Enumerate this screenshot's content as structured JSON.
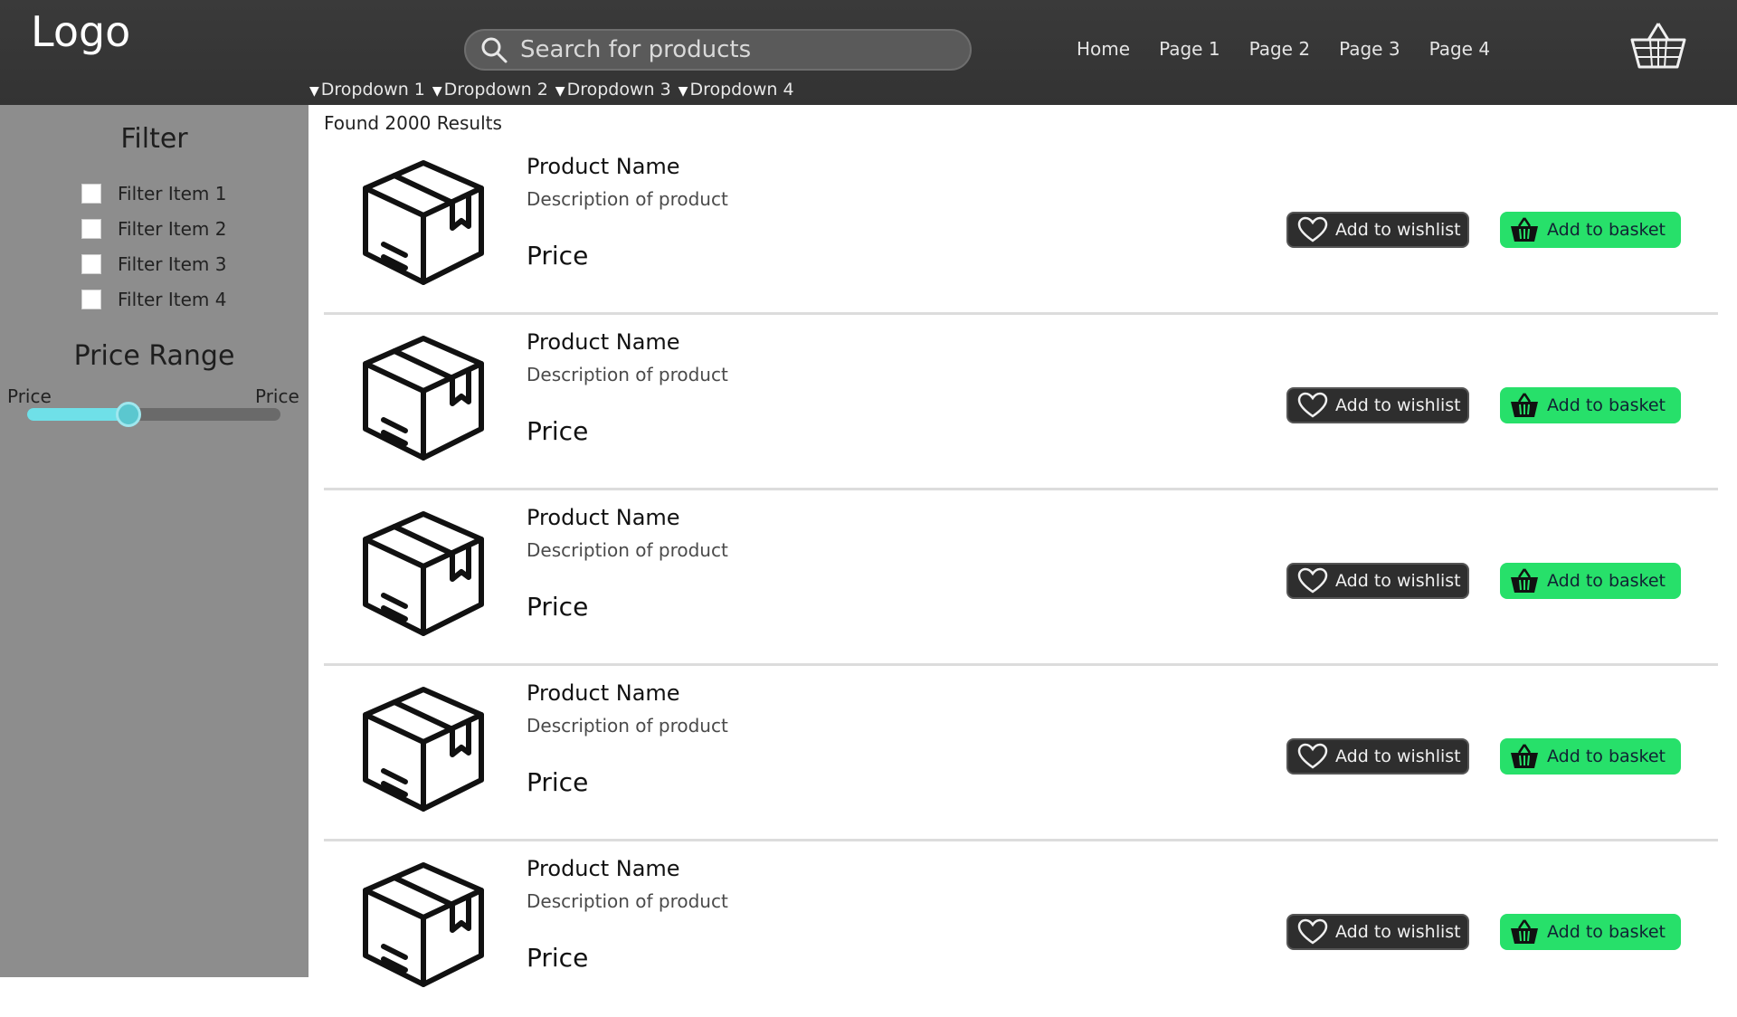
{
  "header": {
    "logo": "Logo",
    "search_placeholder": "Search for products",
    "nav": [
      "Home",
      "Page 1",
      "Page 2",
      "Page 3",
      "Page 4"
    ],
    "dropdowns": [
      "Dropdown 1",
      "Dropdown 2",
      "Dropdown 3",
      "Dropdown 4"
    ]
  },
  "sidebar": {
    "filter_title": "Filter",
    "filters": [
      "Filter Item 1",
      "Filter Item 2",
      "Filter Item 3",
      "Filter Item 4"
    ],
    "price_title": "Price Range",
    "price_min_label": "Price",
    "price_max_label": "Price",
    "slider_value": 0.4
  },
  "main": {
    "results_text": "Found 2000 Results",
    "products": [
      {
        "name": "Product Name",
        "description": "Description of product",
        "price": "Price",
        "wishlist_label": "Add to wishlist",
        "basket_label": "Add to basket"
      },
      {
        "name": "Product Name",
        "description": "Description of product",
        "price": "Price",
        "wishlist_label": "Add to wishlist",
        "basket_label": "Add to basket"
      },
      {
        "name": "Product Name",
        "description": "Description of product",
        "price": "Price",
        "wishlist_label": "Add to wishlist",
        "basket_label": "Add to basket"
      },
      {
        "name": "Product Name",
        "description": "Description of product",
        "price": "Price",
        "wishlist_label": "Add to wishlist",
        "basket_label": "Add to basket"
      },
      {
        "name": "Product Name",
        "description": "Description of product",
        "price": "Price",
        "wishlist_label": "Add to wishlist",
        "basket_label": "Add to basket"
      }
    ]
  },
  "colors": {
    "header_bg": "#333333",
    "sidebar_bg": "#8d8d8d",
    "accent_green": "#27e06a",
    "slider_accent": "#6fe0e8"
  },
  "icons": {
    "search": "search-icon",
    "cart": "basket-icon",
    "product": "box-icon",
    "wishlist": "heart-icon",
    "basket": "basket-icon"
  }
}
